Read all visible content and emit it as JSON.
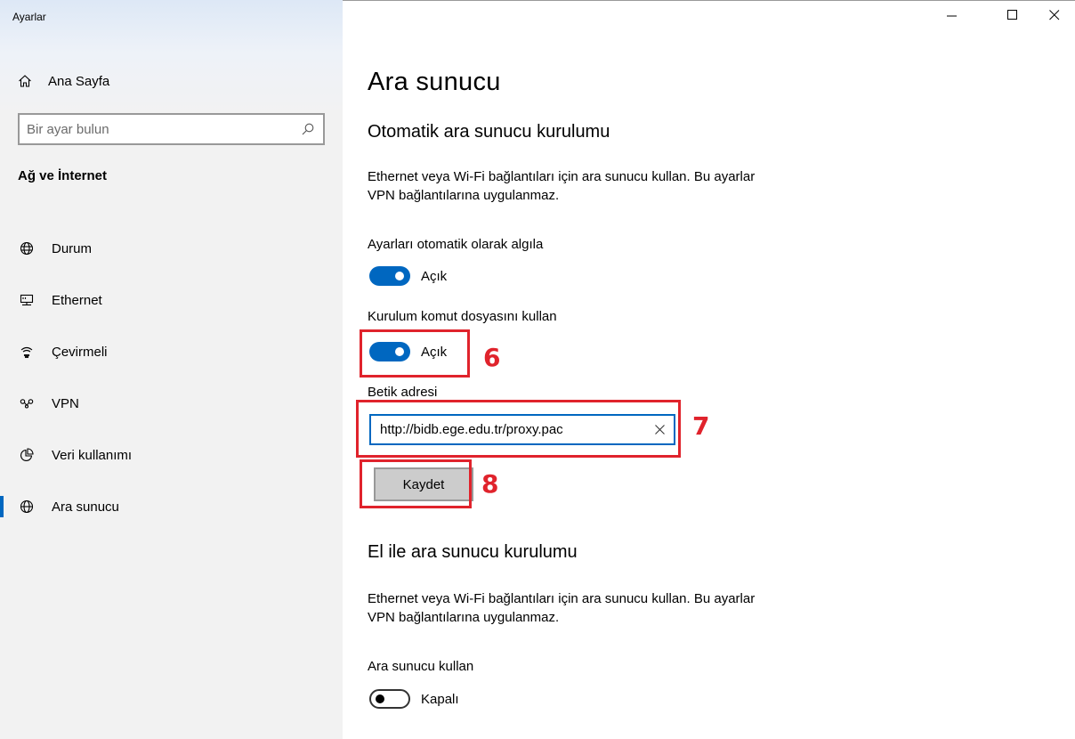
{
  "window": {
    "title": "Ayarlar"
  },
  "sidebar": {
    "home_label": "Ana Sayfa",
    "search_placeholder": "Bir ayar bulun",
    "section_title": "Ağ ve İnternet",
    "items": [
      {
        "label": "Durum",
        "icon": "globe-status-icon"
      },
      {
        "label": "Ethernet",
        "icon": "ethernet-icon"
      },
      {
        "label": "Çevirmeli",
        "icon": "dialup-icon"
      },
      {
        "label": "VPN",
        "icon": "vpn-icon"
      },
      {
        "label": "Veri kullanımı",
        "icon": "data-usage-icon"
      },
      {
        "label": "Ara sunucu",
        "icon": "proxy-globe-icon",
        "active": true
      }
    ]
  },
  "main": {
    "page_title": "Ara sunucu",
    "auto": {
      "heading": "Otomatik ara sunucu kurulumu",
      "description_line1": "Ethernet veya Wi-Fi bağlantıları için ara sunucu kullan. Bu ayarlar",
      "description_line2": "VPN bağlantılarına uygulanmaz.",
      "detect_label": "Ayarları otomatik olarak algıla",
      "detect_state": "Açık",
      "script_label": "Kurulum komut dosyasını kullan",
      "script_state": "Açık",
      "address_label": "Betik adresi",
      "address_value": "http://bidb.ege.edu.tr/proxy.pac",
      "save_label": "Kaydet"
    },
    "manual": {
      "heading": "El ile ara sunucu kurulumu",
      "description_line1": "Ethernet veya Wi-Fi bağlantıları için ara sunucu kullan. Bu ayarlar",
      "description_line2": "VPN bağlantılarına uygulanmaz.",
      "use_proxy_label": "Ara sunucu kullan",
      "use_proxy_state": "Kapalı"
    }
  },
  "annotations": {
    "num6": "6",
    "num7": "7",
    "num8": "8",
    "color": "#e0232c"
  },
  "colors": {
    "accent": "#0067c0",
    "sidebar_bg": "#f2f2f2"
  }
}
